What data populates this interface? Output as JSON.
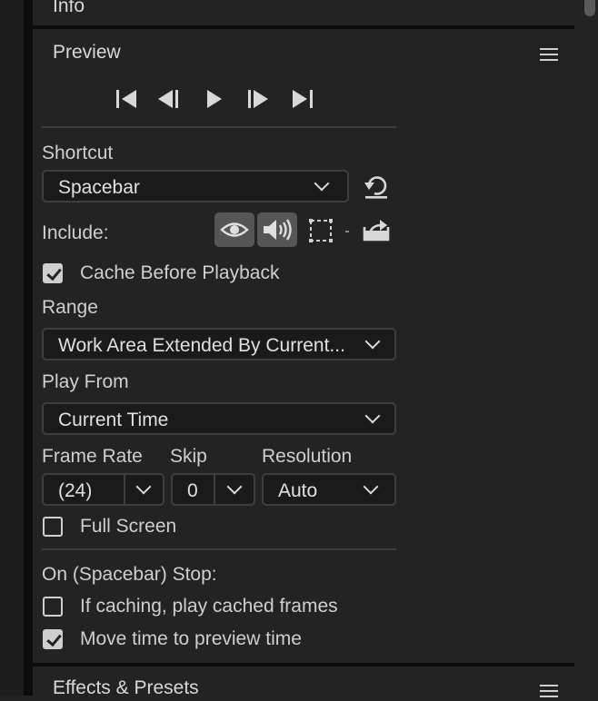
{
  "panels": {
    "info_title": "Info",
    "preview_title": "Preview",
    "effects_title": "Effects & Presets"
  },
  "transport": [
    "first-frame-icon",
    "previous-frame-icon",
    "play-icon",
    "next-frame-icon",
    "last-frame-icon"
  ],
  "shortcut": {
    "label": "Shortcut",
    "value": "Spacebar"
  },
  "include": {
    "label": "Include:",
    "video_on": true,
    "audio_on": true,
    "overlays_on": false
  },
  "cache_before_playback": {
    "label": "Cache Before Playback",
    "checked": true
  },
  "range": {
    "label": "Range",
    "value": "Work Area Extended By Current..."
  },
  "play_from": {
    "label": "Play From",
    "value": "Current Time"
  },
  "frame_rate": {
    "label": "Frame Rate",
    "value": "(24)"
  },
  "skip": {
    "label": "Skip",
    "value": "0"
  },
  "resolution": {
    "label": "Resolution",
    "value": "Auto"
  },
  "full_screen": {
    "label": "Full Screen",
    "checked": false
  },
  "on_stop": {
    "label": "On (Spacebar) Stop:",
    "play_cached": {
      "label": "If caching, play cached frames",
      "checked": false
    },
    "move_time": {
      "label": "Move time to preview time",
      "checked": true
    }
  },
  "colors": {
    "background": "#232323",
    "control": "#1a1a1a",
    "toggle_on": "#565656",
    "text": "#d6d6d6"
  }
}
